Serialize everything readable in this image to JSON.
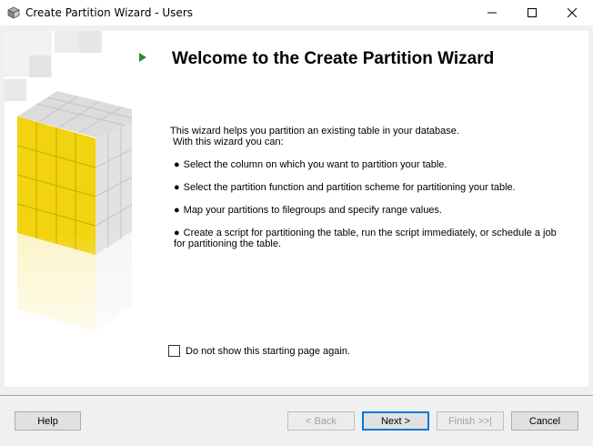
{
  "window": {
    "title": "Create Partition Wizard - Users",
    "app_icon": "wizard-app-icon",
    "controls": [
      "minimize-icon",
      "maximize-icon",
      "close-icon"
    ]
  },
  "page": {
    "heading": "Welcome to the Create Partition Wizard",
    "intro_line1": "This wizard helps you partition an existing table in your database.",
    "intro_line2": "With this wizard you can:",
    "bullets": [
      "Select the column on which you want to partition your table.",
      "Select the partition function and partition scheme for partitioning your table.",
      "Map your partitions to filegroups and specify range values.",
      "Create a script for partitioning the table, run the script immediately, or schedule a job for partitioning the table."
    ],
    "bullet_char": "●",
    "checkbox_label": "Do not show this starting page again.",
    "checkbox_checked": false
  },
  "buttons": {
    "help": "Help",
    "back": "< Back",
    "next": "Next >",
    "finish": "Finish >>|",
    "cancel": "Cancel"
  },
  "colors": {
    "accent": "#0078d7",
    "play_arrow": "#2e8b2e",
    "cube_yellow": "#f5d300",
    "disabled_text": "#a0a0a0"
  }
}
